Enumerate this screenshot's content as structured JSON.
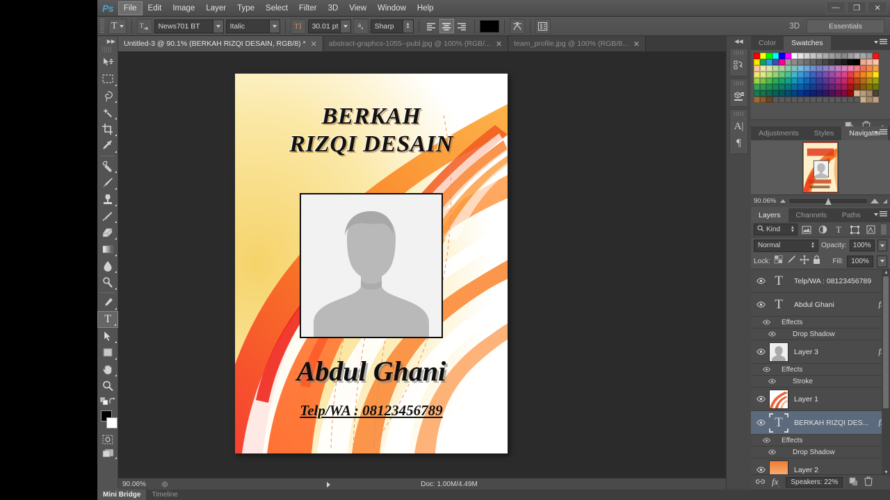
{
  "app": {
    "name": "Photoshop",
    "logo": "Ps"
  },
  "window_controls": [
    {
      "name": "minimize",
      "glyph": "—"
    },
    {
      "name": "restore",
      "glyph": "❐"
    },
    {
      "name": "close",
      "glyph": "✕"
    }
  ],
  "menu": {
    "items": [
      "File",
      "Edit",
      "Image",
      "Layer",
      "Type",
      "Select",
      "Filter",
      "3D",
      "View",
      "Window",
      "Help"
    ],
    "active": "File"
  },
  "options_bar": {
    "tool_icon": "type-tool-icon",
    "orientation_icon": "text-orientation-icon",
    "font_family": "News701 BT",
    "font_style": "Italic",
    "font_size": "30.01 pt",
    "antialias_icon": "anti-alias-icon",
    "antialias_method": "Sharp",
    "align": [
      "align-left",
      "align-center",
      "align-right"
    ],
    "align_active": "align-center",
    "text_color": "#000000",
    "warp_icon": "warp-text-icon",
    "panels_icon": "character-panel-icon",
    "threed_label": "3D",
    "workspace": "Essentials"
  },
  "document_tabs": [
    {
      "label": "Untitled-3 @ 90.1% (BERKAH  RIZQI DESAIN, RGB/8) *",
      "active": true
    },
    {
      "label": "abstract-graphcs-1055--publ.jpg @ 100% (RGB/...",
      "active": false
    },
    {
      "label": "team_profile.jpg @ 100% (RGB/8...",
      "active": false
    }
  ],
  "tools": [
    {
      "name": "move-tool",
      "icon": "move",
      "selected": false,
      "has_more": false
    },
    {
      "name": "rectangular-marquee-tool",
      "icon": "marquee",
      "selected": false,
      "has_more": true
    },
    {
      "name": "lasso-tool",
      "icon": "lasso",
      "selected": false,
      "has_more": true
    },
    {
      "name": "quick-selection-tool",
      "icon": "magic-wand",
      "selected": false,
      "has_more": true
    },
    {
      "name": "crop-tool",
      "icon": "crop",
      "selected": false,
      "has_more": true
    },
    {
      "name": "eyedropper-tool",
      "icon": "eyedropper",
      "selected": false,
      "has_more": true
    },
    {
      "name": "spot-healing-brush-tool",
      "icon": "healing",
      "selected": false,
      "has_more": true
    },
    {
      "name": "brush-tool",
      "icon": "brush",
      "selected": false,
      "has_more": true
    },
    {
      "name": "clone-stamp-tool",
      "icon": "stamp",
      "selected": false,
      "has_more": true
    },
    {
      "name": "history-brush-tool",
      "icon": "history-brush",
      "selected": false,
      "has_more": true
    },
    {
      "name": "eraser-tool",
      "icon": "eraser",
      "selected": false,
      "has_more": true
    },
    {
      "name": "gradient-tool",
      "icon": "gradient",
      "selected": false,
      "has_more": true
    },
    {
      "name": "blur-tool",
      "icon": "blur-drop",
      "selected": false,
      "has_more": true
    },
    {
      "name": "dodge-tool",
      "icon": "dodge",
      "selected": false,
      "has_more": true
    },
    {
      "name": "pen-tool",
      "icon": "pen",
      "selected": false,
      "has_more": true
    },
    {
      "name": "horizontal-type-tool",
      "icon": "type",
      "selected": true,
      "has_more": true
    },
    {
      "name": "path-selection-tool",
      "icon": "arrow",
      "selected": false,
      "has_more": true
    },
    {
      "name": "rectangle-tool",
      "icon": "rectangle",
      "selected": false,
      "has_more": true
    },
    {
      "name": "hand-tool",
      "icon": "hand",
      "selected": false,
      "has_more": true
    },
    {
      "name": "zoom-tool",
      "icon": "zoom",
      "selected": false,
      "has_more": false
    }
  ],
  "color_controls": {
    "foreground": "#000000",
    "background": "#ffffff",
    "default_colors_icon": "default-colors-icon",
    "swap_colors_icon": "swap-colors-icon",
    "quick_mask_icon": "quick-mask-icon",
    "screen_mode_icon": "screen-mode-icon"
  },
  "artwork": {
    "title_line1": "BERKAH",
    "title_line2": "RIZQI DESAIN",
    "name": "Abdul Ghani",
    "phone": "Telp/WA : 08123456789",
    "photo_placeholder": "person-silhouette"
  },
  "doc_status": {
    "zoom": "90.06%",
    "doc_info": "Doc: 1.00M/4.49M"
  },
  "bottom_tabs": [
    {
      "label": "Mini Bridge",
      "active": true
    },
    {
      "label": "Timeline",
      "active": false
    }
  ],
  "dock_strip": {
    "collapse_icon": "collapse-panels-icon",
    "groups": [
      {
        "name": "history-panel-icon",
        "glyph": "↶"
      },
      {
        "name": "3d-panel-icon",
        "glyph": "❑"
      },
      {
        "name": "character-panel-icon",
        "glyph": "A"
      },
      {
        "name": "paragraph-panel-icon",
        "glyph": "¶"
      }
    ]
  },
  "swatches_panel": {
    "tabs": [
      {
        "label": "Color",
        "active": false
      },
      {
        "label": "Swatches",
        "active": true
      }
    ],
    "new_swatch_icon": "new-swatch-icon",
    "delete_swatch_icon": "trash-icon",
    "colors": [
      "#ff0000",
      "#ffff00",
      "#00ff00",
      "#00ffff",
      "#0000ff",
      "#ff00ff",
      "#ffffff",
      "#e6e6e6",
      "#d4d4d4",
      "#c6c6c6",
      "#b8b8b8",
      "#ababab",
      "#a0a0a0",
      "#949494",
      "#8a8a8a",
      "#9e9e9e",
      "#b0b0b0",
      "#a8a8a8",
      "#9b9b9b",
      "#ff1111",
      "#ffe800",
      "#11a35a",
      "#2f9be0",
      "#3b4fb0",
      "#ff0090",
      "#9a9a9a",
      "#8c8c8c",
      "#7e7e7e",
      "#707070",
      "#626262",
      "#545454",
      "#464646",
      "#383838",
      "#2a2a2a",
      "#1c1c1c",
      "#0a0a0a",
      "#000000",
      "#f2a98d",
      "#f5b89a",
      "#f8c6a8",
      "#f8c99a",
      "#f6e2b0",
      "#d8e8a8",
      "#bcdba2",
      "#a6d4a4",
      "#8ecaa8",
      "#7fc5bb",
      "#79bede",
      "#6fa8dc",
      "#6f8fd0",
      "#7b80c8",
      "#8f80c4",
      "#a87fc0",
      "#c27fc0",
      "#db7fb8",
      "#ef7fa8",
      "#f27f88",
      "#ee6f58",
      "#f08a4a",
      "#f3a24c",
      "#f7e07a",
      "#dfe88a",
      "#b8de7c",
      "#92d27c",
      "#6fc67e",
      "#4fbd9a",
      "#46b4cf",
      "#3f9ad8",
      "#3b7fce",
      "#4161bd",
      "#5a52b4",
      "#7a4fae",
      "#9d4ca8",
      "#c0489e",
      "#d94587",
      "#e53f4f",
      "#ef6a2a",
      "#f2881f",
      "#f4a51b",
      "#fce216",
      "#9fd04a",
      "#7cc348",
      "#4fb84c",
      "#2aac52",
      "#1aa36b",
      "#12a08f",
      "#1597b6",
      "#1280c4",
      "#1166b6",
      "#1c4fa6",
      "#3a3f9e",
      "#5c3896",
      "#80338e",
      "#a52f84",
      "#c42a6a",
      "#cf2727",
      "#c0471c",
      "#b96a18",
      "#b08f14",
      "#9ca310",
      "#3aa05a",
      "#2e9850",
      "#1f8f52",
      "#15865c",
      "#0f7d6a",
      "#0a7580",
      "#0b6d99",
      "#0a5fae",
      "#0a4ea0",
      "#153f92",
      "#2b318a",
      "#46297f",
      "#6a2476",
      "#8a1f6c",
      "#a81b55",
      "#a81818",
      "#8c3a14",
      "#8a5a10",
      "#80720c",
      "#6e7a09",
      "#1c7a52",
      "#16714e",
      "#0f6850",
      "#0a5f58",
      "#065660",
      "#044c74",
      "#054286",
      "#04358f",
      "#062a80",
      "#0e2176",
      "#1e1a6e",
      "#33155f",
      "#4d1157",
      "#6a0d4e",
      "#840a3e",
      "#960808",
      "#d4b896",
      "#b89c7e",
      "#a68a6e",
      "#4a4438",
      "#a06a3a",
      "#8a5a2e",
      "#6e4522",
      "#5a5a5a",
      "#5a5a5a",
      "#5a5a5a",
      "#5a5a5a",
      "#5a5a5a",
      "#5a5a5a",
      "#5a5a5a",
      "#5a5a5a",
      "#5a5a5a",
      "#5a5a5a",
      "#5a5a5a",
      "#5a5a5a",
      "#5a5a5a",
      "#5a5a5a",
      "#c8b090",
      "#a88a6a",
      "#c0a084"
    ]
  },
  "navigator_panel": {
    "tabs": [
      {
        "label": "Adjustments",
        "active": false
      },
      {
        "label": "Styles",
        "active": false
      },
      {
        "label": "Navigator",
        "active": true
      }
    ],
    "zoom": "90.06%",
    "zoom_out_icon": "zoom-out-icon",
    "zoom_in_icon": "zoom-in-icon",
    "thumbnail": "document-thumbnail"
  },
  "layers_panel": {
    "tabs": [
      {
        "label": "Layers",
        "active": true
      },
      {
        "label": "Channels",
        "active": false
      },
      {
        "label": "Paths",
        "active": false
      }
    ],
    "filter": {
      "search_icon": "search-icon",
      "kind_label": "Kind",
      "filter_icons": [
        "pixel-filter-icon",
        "adjustment-filter-icon",
        "type-filter-icon",
        "shape-filter-icon",
        "smart-object-filter-icon"
      ],
      "toggle_icon": "filter-toggle-icon"
    },
    "blend_mode": "Normal",
    "opacity_label": "Opacity:",
    "opacity_value": "100%",
    "lock_label": "Lock:",
    "lock_icons": [
      "lock-transparent-icon",
      "lock-image-icon",
      "lock-position-icon",
      "lock-all-icon"
    ],
    "fill_label": "Fill:",
    "fill_value": "100%",
    "rows": [
      {
        "type": "layer",
        "name": "Telp/WA : 08123456789",
        "thumb": "type",
        "fx": false,
        "selected": false,
        "visible": true
      },
      {
        "type": "layer",
        "name": "Abdul Ghani",
        "thumb": "type",
        "fx": true,
        "selected": false,
        "visible": true
      },
      {
        "type": "effects",
        "name": "Effects",
        "visible": true
      },
      {
        "type": "effect",
        "name": "Drop Shadow",
        "visible": true
      },
      {
        "type": "layer",
        "name": "Layer 3",
        "thumb": "photo",
        "fx": true,
        "selected": false,
        "visible": true
      },
      {
        "type": "effects",
        "name": "Effects",
        "visible": true
      },
      {
        "type": "effect",
        "name": "Stroke",
        "visible": true
      },
      {
        "type": "layer",
        "name": "Layer 1",
        "thumb": "swoosh",
        "fx": false,
        "selected": false,
        "visible": true
      },
      {
        "type": "layer",
        "name": "BERKAH  RIZQI DES...",
        "thumb": "type-selected",
        "fx": true,
        "selected": true,
        "visible": true
      },
      {
        "type": "effects",
        "name": "Effects",
        "visible": true
      },
      {
        "type": "effect",
        "name": "Drop Shadow",
        "visible": true
      },
      {
        "type": "layer",
        "name": "Layer 2",
        "thumb": "orange",
        "fx": false,
        "selected": false,
        "visible": true
      },
      {
        "type": "layer",
        "name": "",
        "thumb": "white",
        "fx": false,
        "selected": false,
        "visible": true
      }
    ],
    "footer": {
      "link_icon": "link-layers-icon",
      "fx_icon": "layer-style-icon",
      "speakers": "Speakers: 22%",
      "new_layer_icon": "new-layer-icon",
      "delete_layer_icon": "trash-icon"
    }
  }
}
